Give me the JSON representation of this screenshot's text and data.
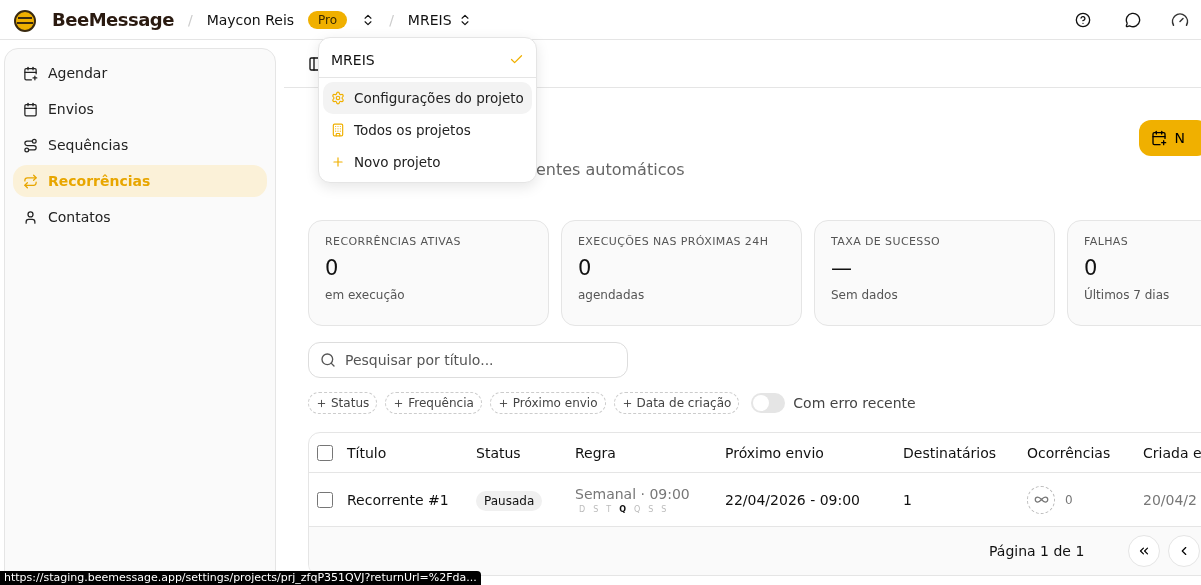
{
  "header": {
    "logo": "BeeMessage",
    "org": "Maycon Reis",
    "plan": "Pro",
    "project": "MREIS",
    "separators": [
      "/",
      "/"
    ]
  },
  "project_menu": {
    "current": {
      "label": "MREIS",
      "checked": true
    },
    "items": [
      {
        "kind": "settings",
        "label": "Configurações do projeto",
        "highlighted": true
      },
      {
        "kind": "building",
        "label": "Todos os projetos",
        "highlighted": false
      },
      {
        "kind": "plus",
        "label": "Novo projeto",
        "highlighted": false
      }
    ]
  },
  "sidebar": {
    "items": [
      {
        "kind": "calendar-plus",
        "label": "Agendar",
        "selected": false
      },
      {
        "kind": "calendar",
        "label": "Envios",
        "selected": false
      },
      {
        "kind": "route",
        "label": "Sequências",
        "selected": false
      },
      {
        "kind": "repeat",
        "label": "Recorrências",
        "selected": true
      },
      {
        "kind": "user",
        "label": "Contatos",
        "selected": false
      }
    ]
  },
  "page": {
    "subtitle": "entes automáticos",
    "new_button": "N"
  },
  "stats": [
    {
      "label": "RECORRÊNCIAS ATIVAS",
      "value": "0",
      "caption": "em execução"
    },
    {
      "label": "EXECUÇÕES NAS PRÓXIMAS 24H",
      "value": "0",
      "caption": "agendadas"
    },
    {
      "label": "TAXA DE SUCESSO",
      "value": "—",
      "caption": "Sem dados"
    },
    {
      "label": "FALHAS",
      "value": "0",
      "caption": "Últimos 7 dias"
    }
  ],
  "search": {
    "placeholder": "Pesquisar por título..."
  },
  "filters": [
    "Status",
    "Frequência",
    "Próximo envio",
    "Data de criação"
  ],
  "error_toggle": {
    "label": "Com erro recente",
    "on": false
  },
  "table": {
    "all_checked": false,
    "columns": [
      "Título",
      "Status",
      "Regra",
      "Próximo envio",
      "Destinatários",
      "Ocorrências",
      "Criada e"
    ],
    "rows": [
      {
        "checked": false,
        "title": "Recorrente #1",
        "status": "Pausada",
        "rule": "Semanal · 09:00",
        "days": [
          {
            "label": "D",
            "selected": false
          },
          {
            "label": "S",
            "selected": false
          },
          {
            "label": "T",
            "selected": false
          },
          {
            "label": "Q",
            "selected": true
          },
          {
            "label": "Q",
            "selected": false
          },
          {
            "label": "S",
            "selected": false
          },
          {
            "label": "S",
            "selected": false
          }
        ],
        "next": "22/04/2026 - 09:00",
        "recipients": "1",
        "occurrences": "0",
        "created": "20/04/2"
      }
    ]
  },
  "pagination": {
    "label": "Página 1 de 1"
  },
  "status_url": "https://staging.beemessage.app/settings/projects/prj_zfqP351QVJ?returnUrl=%2Fda..."
}
